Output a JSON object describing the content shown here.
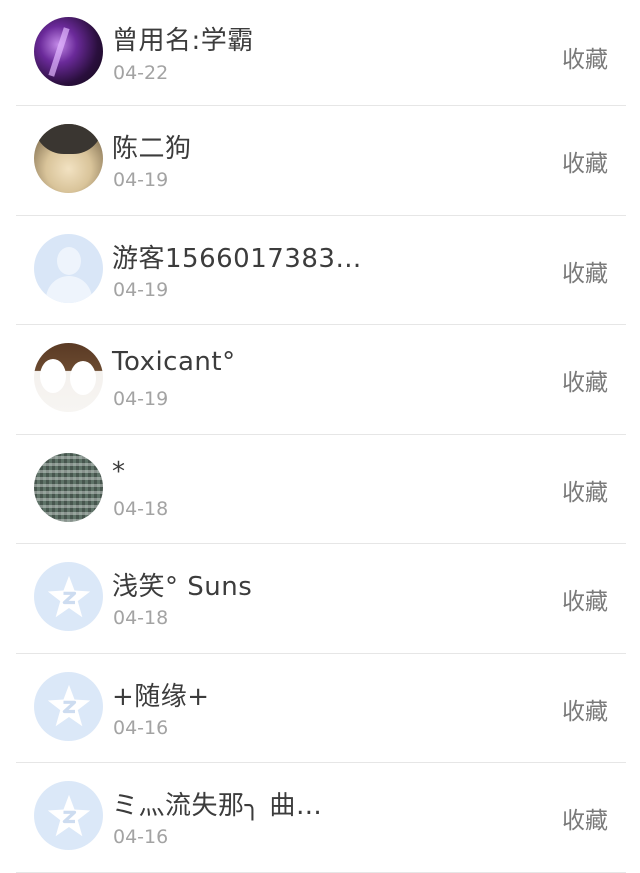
{
  "list": {
    "items": [
      {
        "name": "曾用名:学霸",
        "date": "04-22",
        "action": "收藏"
      },
      {
        "name": "陈二狗",
        "date": "04-19",
        "action": "收藏"
      },
      {
        "name": "游客1566017383…",
        "date": "04-19",
        "action": "收藏"
      },
      {
        "name": "Toxicant°",
        "date": "04-19",
        "action": "收藏"
      },
      {
        "name": "*",
        "date": "04-18",
        "action": "收藏"
      },
      {
        "name": "浅笑° Suns",
        "date": "04-18",
        "action": "收藏"
      },
      {
        "name": "+随缘+",
        "date": "04-16",
        "action": "收藏"
      },
      {
        "name": "ミ灬流失那╮ 曲…",
        "date": "04-16",
        "action": "收藏"
      }
    ]
  },
  "colors": {
    "name_text": "#3c3c3c",
    "date_text": "#a3a3a3",
    "action_text": "#7a7a7a",
    "divider": "#e6e6e6",
    "default_avatar_bg": "#dbe8f8"
  },
  "icons": {
    "default_avatar": "person-silhouette-icon",
    "qq_avatar": "qq-star-icon"
  }
}
